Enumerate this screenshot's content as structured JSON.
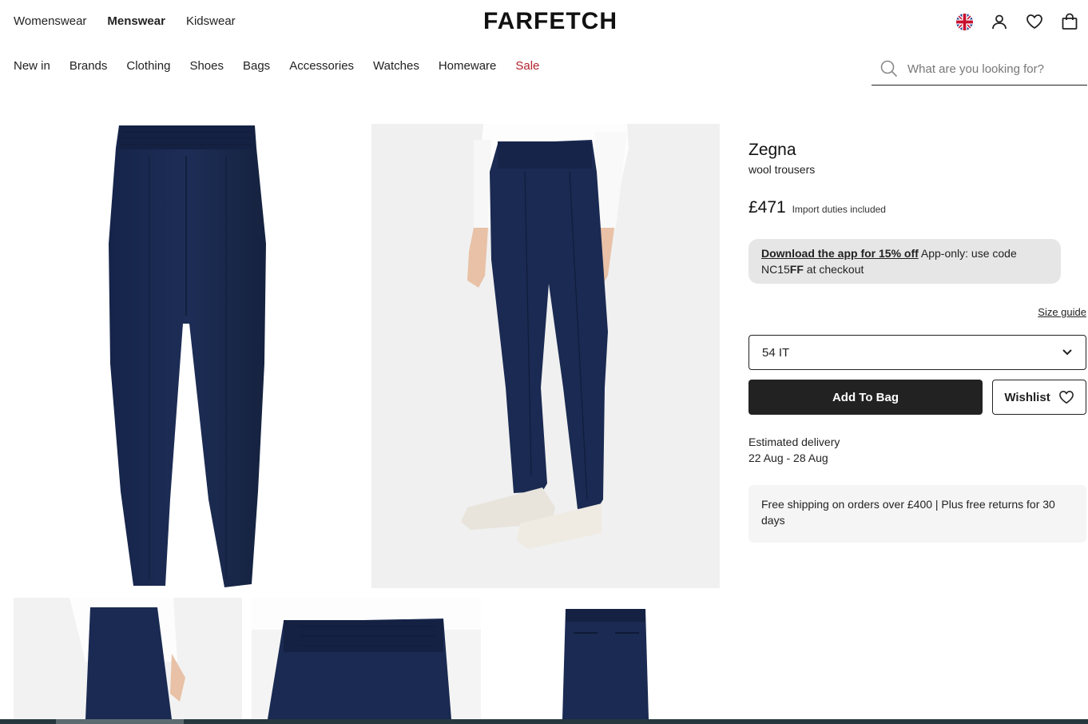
{
  "header": {
    "genders": [
      "Womenswear",
      "Menswear",
      "Kidswear"
    ],
    "active_gender": "Menswear",
    "logo": "FARFETCH",
    "icons": [
      "uk-flag-icon",
      "account-icon",
      "wishlist-heart-icon",
      "shopping-bag-icon"
    ]
  },
  "nav": {
    "items": [
      "New in",
      "Brands",
      "Clothing",
      "Shoes",
      "Bags",
      "Accessories",
      "Watches",
      "Homeware"
    ],
    "sale": "Sale",
    "sale_color": "#b3212c"
  },
  "search": {
    "placeholder": "What are you looking for?"
  },
  "product": {
    "brand": "Zegna",
    "name": "wool trousers",
    "price": "£471",
    "duty_note": "Import duties included",
    "promo_link": "Download the app for 15% off",
    "promo_text_1": " App-only: use code ",
    "promo_code_prefix": "NC15",
    "promo_code_bold": "FF",
    "promo_text_2": " at checkout",
    "size_guide": "Size guide",
    "selected_size": "54 IT",
    "add_to_bag": "Add To Bag",
    "wishlist": "Wishlist",
    "delivery_label": "Estimated delivery",
    "delivery_dates": "22 Aug - 28 Aug",
    "shipping_note": "Free shipping on orders over £400 | Plus free returns for 30 days"
  },
  "colors": {
    "trouser_navy": "#1b2a4e",
    "button_dark": "#222222"
  }
}
